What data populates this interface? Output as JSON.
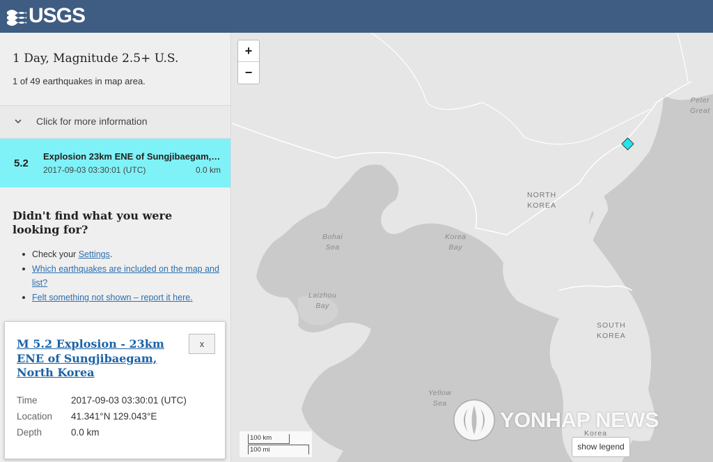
{
  "header": {
    "logo_text": "USGS"
  },
  "sidebar": {
    "list_title": "1 Day, Magnitude 2.5+ U.S.",
    "list_count": "1 of 49 earthquakes in map area.",
    "more_info_label": "Click for more information",
    "earthquake": {
      "magnitude": "5.2",
      "place": "Explosion 23km ENE of Sungjibaegam, North Korea",
      "time": "2017-09-03 03:30:01 (UTC)",
      "depth": "0.0 km"
    },
    "help": {
      "title": "Didn't find what you were looking for?",
      "item1_prefix": "Check your ",
      "item1_link": "Settings",
      "item1_suffix": ".",
      "item2_link": "Which earthquakes are included on the map and list?",
      "item3_link": "Felt something not shown – report it here."
    }
  },
  "popup": {
    "title": "M 5.2 Explosion - 23km ENE of Sungjibaegam, North Korea",
    "close_label": "x",
    "rows": [
      {
        "key": "Time",
        "value": "2017-09-03 03:30:01 (UTC)"
      },
      {
        "key": "Location",
        "value": "41.341°N 129.043°E"
      },
      {
        "key": "Depth",
        "value": "0.0 km"
      }
    ]
  },
  "map": {
    "zoom_in": "+",
    "zoom_out": "−",
    "labels": {
      "north_korea_1": "NORTH",
      "north_korea_2": "KOREA",
      "south_korea_1": "SOUTH",
      "south_korea_2": "KOREA",
      "bohai_1": "Bohai",
      "bohai_2": "Sea",
      "korea_bay_1": "Korea",
      "korea_bay_2": "Bay",
      "laizhou_1": "Laizhou",
      "laizhou_2": "Bay",
      "yellow_1": "Yellow",
      "yellow_2": "Sea",
      "peter_1": "Peter",
      "peter_2": "Great",
      "korea_bottom": "Korea"
    },
    "scale_km": "100 km",
    "scale_mi": "100 mi",
    "legend_button": "show legend",
    "water_color": "#cacaca",
    "land_color": "#e6e6e6",
    "marker_color": "#22e6ea"
  },
  "watermark": {
    "text": "YONHAP NEWS"
  }
}
